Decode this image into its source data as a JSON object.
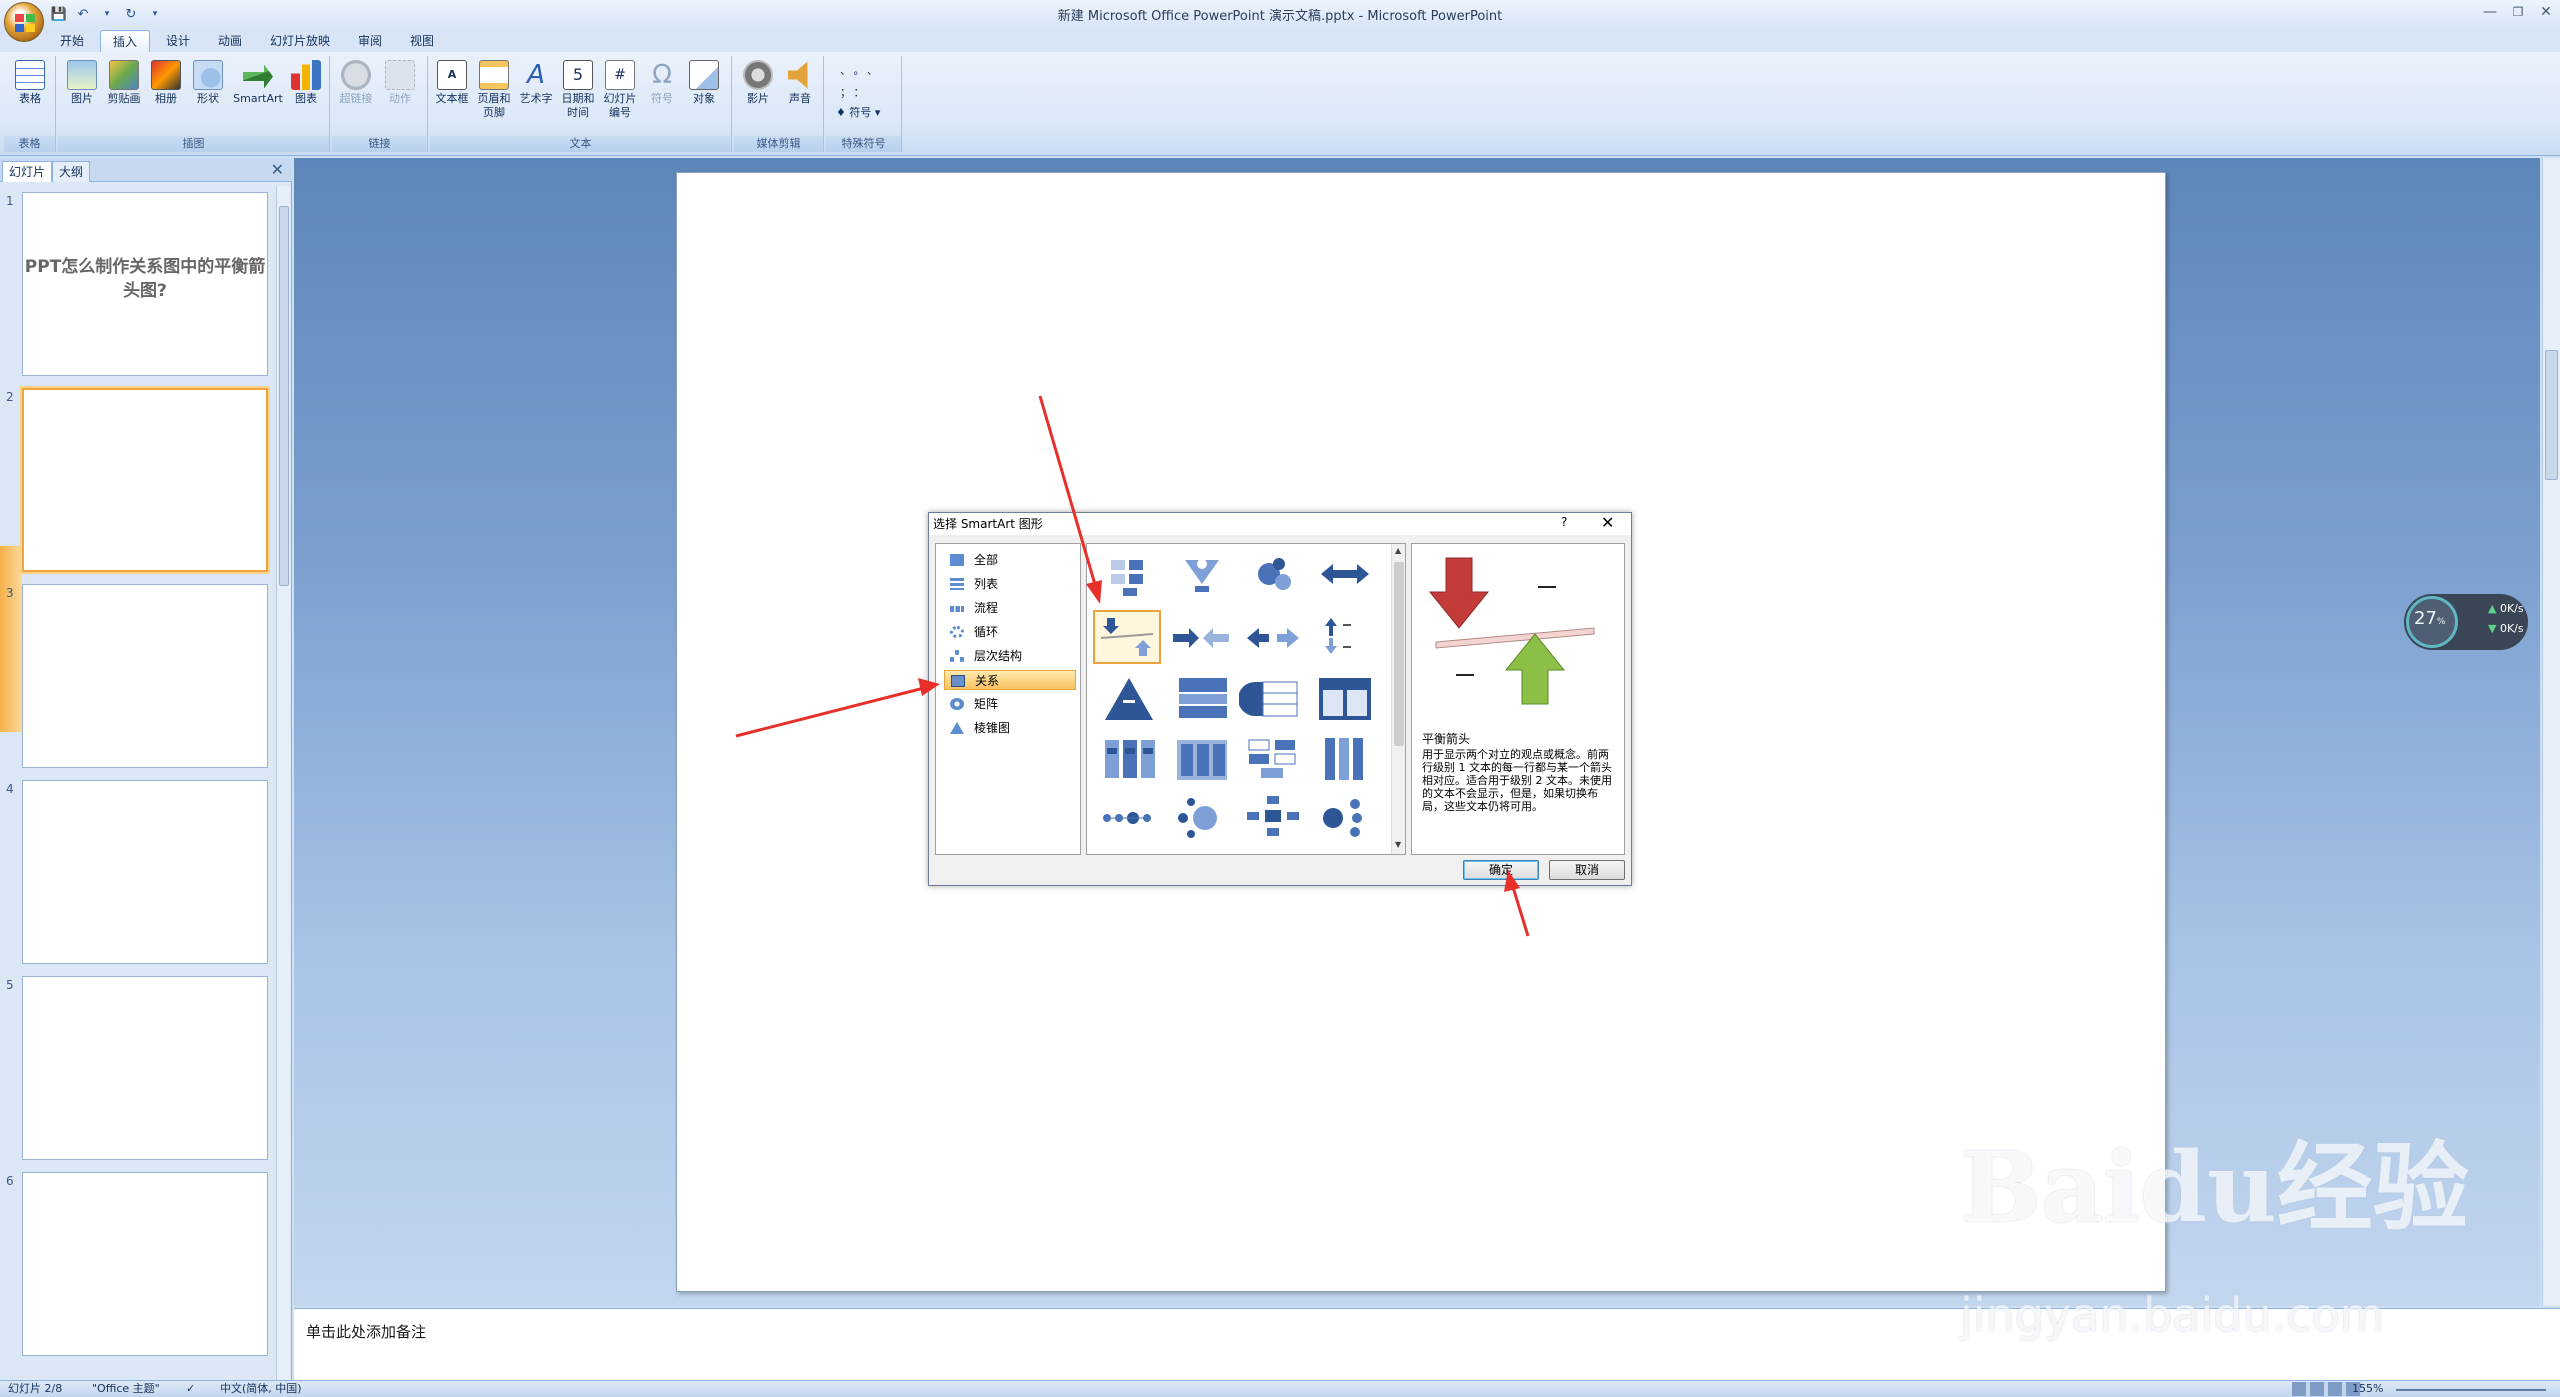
{
  "window": {
    "title": "新建 Microsoft Office PowerPoint 演示文稿.pptx - Microsoft PowerPoint"
  },
  "ribbon": {
    "tabs": [
      "开始",
      "插入",
      "设计",
      "动画",
      "幻灯片放映",
      "审阅",
      "视图"
    ],
    "active_tab": "插入",
    "groups": [
      {
        "label": "表格",
        "buttons": [
          "表格"
        ]
      },
      {
        "label": "插图",
        "buttons": [
          "图片",
          "剪贴画",
          "相册",
          "形状",
          "SmartArt",
          "图表"
        ]
      },
      {
        "label": "链接",
        "buttons": [
          "超链接",
          "动作"
        ]
      },
      {
        "label": "文本",
        "buttons": [
          "文本框",
          "页眉和页脚",
          "艺术字",
          "日期和时间",
          "幻灯片编号",
          "符号",
          "对象"
        ]
      },
      {
        "label": "媒体剪辑",
        "buttons": [
          "影片",
          "声音"
        ]
      },
      {
        "label": "特殊符号",
        "buttons": [
          "符号"
        ]
      }
    ]
  },
  "panel": {
    "tabs": [
      "幻灯片",
      "大纲"
    ],
    "slides": [
      {
        "num": "1",
        "title": "PPT怎么制作关系图中的平衡箭头图?"
      },
      {
        "num": "2",
        "title": ""
      },
      {
        "num": "3",
        "title": ""
      },
      {
        "num": "4",
        "title": ""
      },
      {
        "num": "5",
        "title": ""
      },
      {
        "num": "6",
        "title": ""
      }
    ]
  },
  "notes": {
    "placeholder": "单击此处添加备注"
  },
  "dialog": {
    "title": "选择 SmartArt 图形",
    "help": "?",
    "categories": [
      "全部",
      "列表",
      "流程",
      "循环",
      "层次结构",
      "关系",
      "矩阵",
      "棱锥图"
    ],
    "selected_category": "关系",
    "preview_name": "平衡箭头",
    "preview_desc": "用于显示两个对立的观点或概念。前两行级别 1 文本的每一行都与某一个箭头相对应。适合用于级别 2 文本。未使用的文本不会显示，但是，如果切换布局，这些文本仍将可用。",
    "ok": "确定",
    "cancel": "取消"
  },
  "statusbar": {
    "slide": "幻灯片 2/8",
    "theme": "\"Office 主题\"",
    "lang": "中文(简体, 中国)",
    "zoom": "155%"
  },
  "widget": {
    "cpu": "27",
    "cpu_unit": "%",
    "up": "0K/s",
    "down": "0K/s"
  },
  "watermark": {
    "brand": "Baidu经验",
    "url": "jingyan.baidu.com"
  }
}
